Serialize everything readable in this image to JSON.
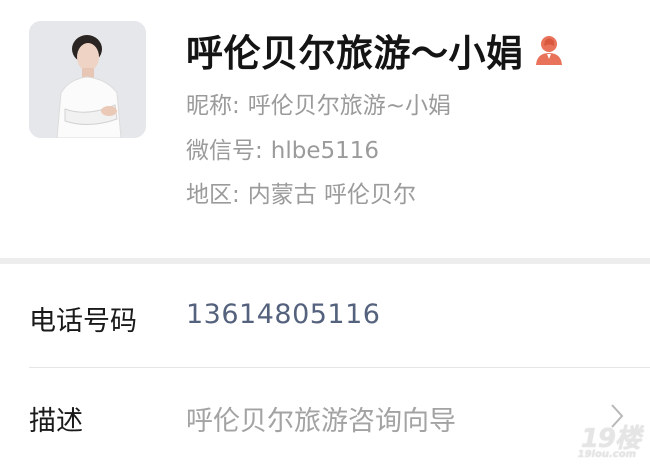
{
  "profile": {
    "display_name": "呼伦贝尔旅游～小娟",
    "gender_icon": "female-user-icon",
    "gender_color": "#e8735a",
    "nickname_label": "昵称:",
    "nickname_value": "呼伦贝尔旅游~小娟",
    "wechat_label": "微信号:",
    "wechat_value": "hlbe5116",
    "region_label": "地区:",
    "region_value": "内蒙古  呼伦贝尔"
  },
  "rows": {
    "phone": {
      "label": "电话号码",
      "value": "13614805116",
      "color": "#55627d"
    },
    "description": {
      "label": "描述",
      "value": "呼伦贝尔旅游咨询向导",
      "icon": "chevron-right-icon"
    }
  },
  "watermark": {
    "main": "19楼",
    "sub": "19lou.com"
  }
}
